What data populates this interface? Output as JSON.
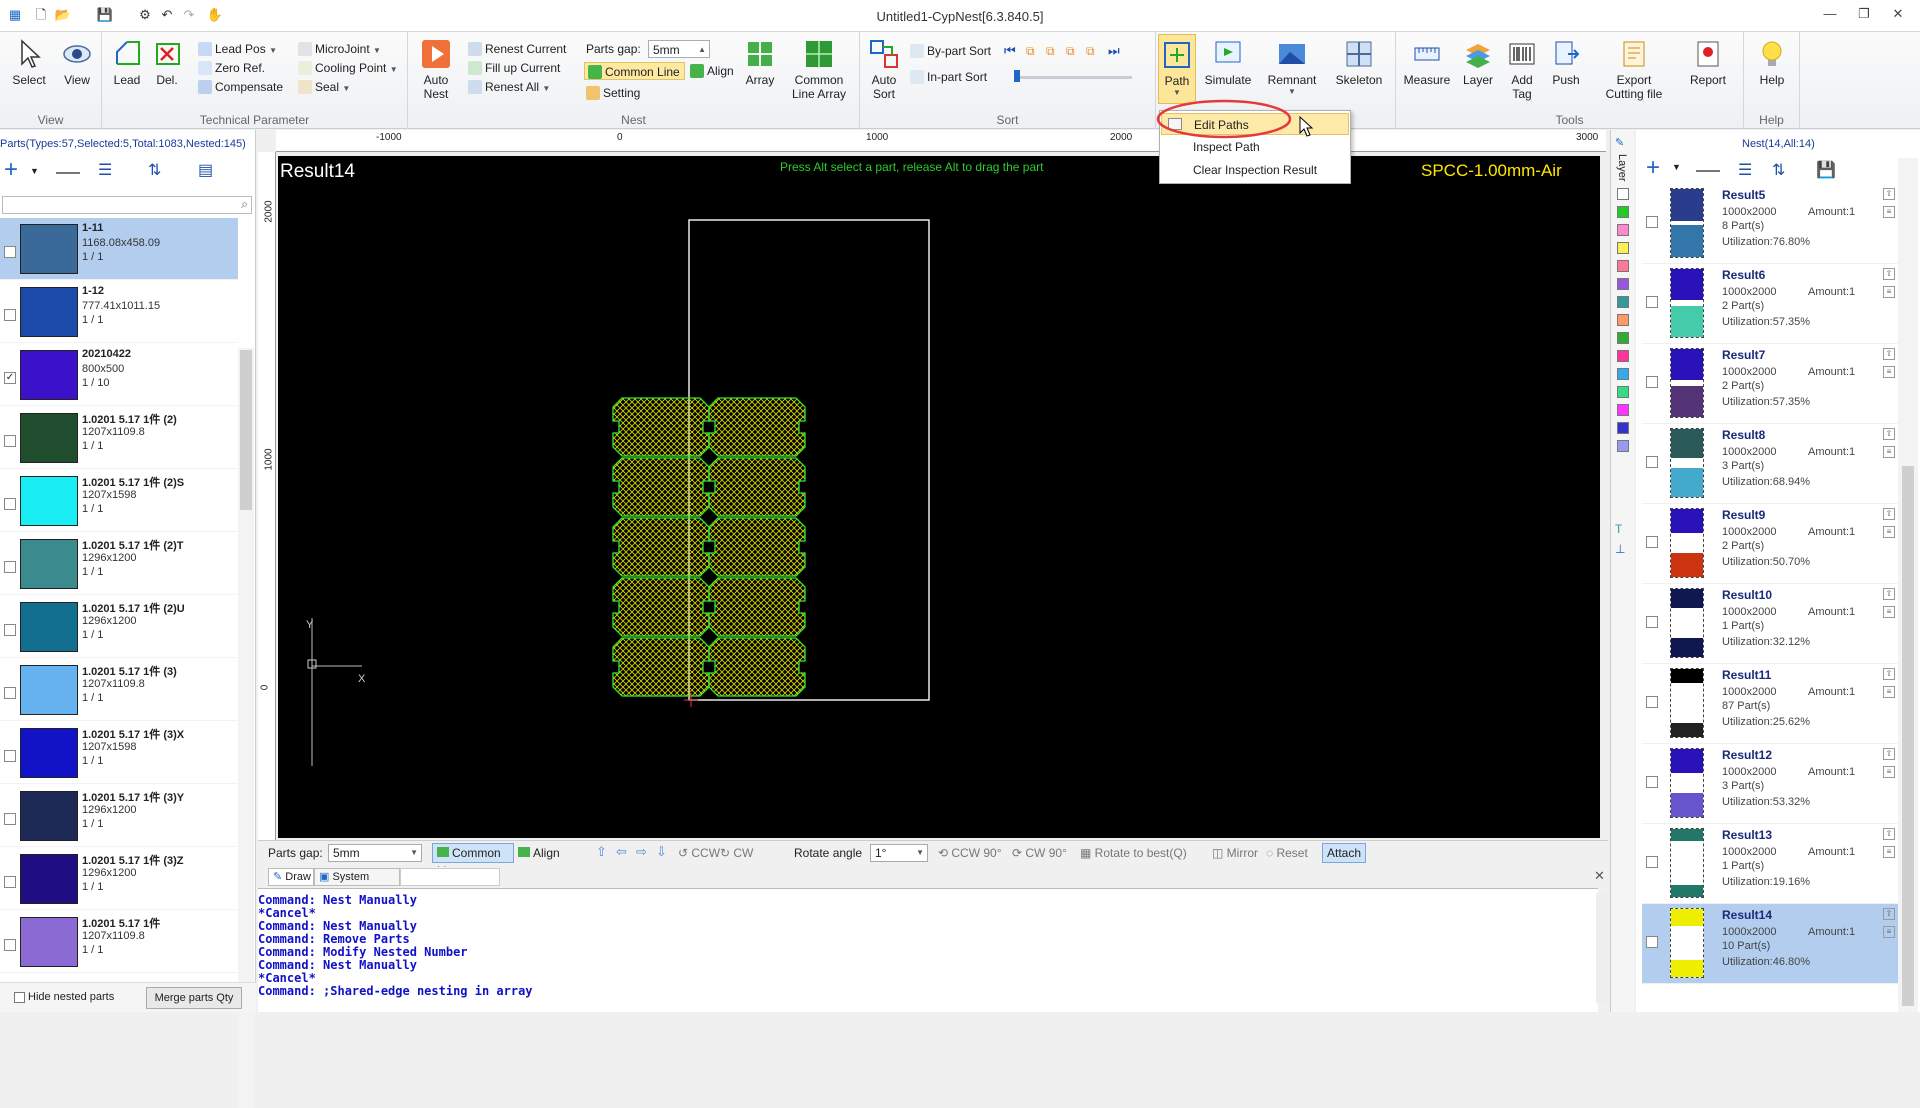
{
  "window": {
    "title": "Untitled1-CypNest[6.3.840.5]"
  },
  "ribbon": {
    "view": {
      "select": "Select",
      "view": "View",
      "group": "View"
    },
    "technical": {
      "lead": "Lead",
      "del": "Del.",
      "lead_pos": "Lead Pos",
      "zero_ref": "Zero Ref.",
      "compensate": "Compensate",
      "microjoint": "MicroJoint",
      "cooling_point": "Cooling Point",
      "seal": "Seal",
      "group": "Technical Parameter"
    },
    "nest": {
      "auto_nest": "Auto\nNest",
      "renest_current": "Renest Current",
      "fill_up_current": "Fill up Current",
      "renest_all": "Renest All",
      "parts_gap_label": "Parts gap:",
      "parts_gap_value": "5mm",
      "common_line": "Common Line",
      "align": "Align",
      "setting": "Setting",
      "array": "Array",
      "common_line_array": "Common\nLine Array",
      "group": "Nest"
    },
    "sort": {
      "auto_sort": "Auto\nSort",
      "by_part_sort": "By-part Sort",
      "in_part_sort": "In-part Sort",
      "group": "Sort"
    },
    "path": {
      "path": "Path",
      "simulate": "Simulate",
      "remnant": "Remnant",
      "skeleton": "Skeleton"
    },
    "tools": {
      "measure": "Measure",
      "layer": "Layer",
      "add_tag": "Add\nTag",
      "push": "Push",
      "export": "Export\nCutting file",
      "report": "Report",
      "group": "Tools"
    },
    "help": {
      "help": "Help",
      "group": "Help"
    }
  },
  "path_menu": {
    "items": [
      "Edit Paths",
      "Inspect Path",
      "Clear Inspection Result"
    ]
  },
  "parts": {
    "status": "Parts(Types:57,Selected:5,Total:1083,Nested:145)",
    "items": [
      {
        "name": "1-11",
        "size": "1168.08x458.09",
        "count": "1 / 1",
        "color": "#3a6a9a",
        "checked": false,
        "selected": true
      },
      {
        "name": "1-12",
        "size": "777.41x1011.15",
        "count": "1 / 1",
        "color": "#1b4aa8",
        "checked": false,
        "selected": false
      },
      {
        "name": "20210422",
        "size": "800x500",
        "count": "1 / 10",
        "color": "#3b12c9",
        "checked": true,
        "selected": false
      },
      {
        "name": "1.0201 5.17 1件 (2)",
        "size": "1207x1109.8",
        "count": "1 / 1",
        "color": "#1f4d2e",
        "checked": false,
        "selected": false
      },
      {
        "name": "1.0201 5.17 1件 (2)S",
        "size": "1207x1598",
        "count": "1 / 1",
        "color": "#19eef5",
        "checked": false,
        "selected": false
      },
      {
        "name": "1.0201 5.17 1件 (2)T",
        "size": "1296x1200",
        "count": "1 / 1",
        "color": "#3a8a8e",
        "checked": false,
        "selected": false
      },
      {
        "name": "1.0201 5.17 1件 (2)U",
        "size": "1296x1200",
        "count": "1 / 1",
        "color": "#136f8f",
        "checked": false,
        "selected": false
      },
      {
        "name": "1.0201 5.17 1件 (3)",
        "size": "1207x1109.8",
        "count": "1 / 1",
        "color": "#66b3f0",
        "checked": false,
        "selected": false
      },
      {
        "name": "1.0201 5.17 1件 (3)X",
        "size": "1207x1598",
        "count": "1 / 1",
        "color": "#1212c6",
        "checked": false,
        "selected": false
      },
      {
        "name": "1.0201 5.17 1件 (3)Y",
        "size": "1296x1200",
        "count": "1 / 1",
        "color": "#1d2a55",
        "checked": false,
        "selected": false
      },
      {
        "name": "1.0201 5.17 1件 (3)Z",
        "size": "1296x1200",
        "count": "1 / 1",
        "color": "#1f0d82",
        "checked": false,
        "selected": false
      },
      {
        "name": "1.0201 5.17 1件",
        "size": "1207x1109.8",
        "count": "1 / 1",
        "color": "#8c6ad4",
        "checked": false,
        "selected": false
      }
    ],
    "hide_nested": "Hide nested parts",
    "merge_btn": "Merge parts Qty"
  },
  "canvas": {
    "result_label": "Result14",
    "hint": "Press Alt select a part, release Alt to drag the part",
    "material": "SPCC-1.00mm-Air",
    "hruler": [
      "-1000",
      "0",
      "1000",
      "2000",
      "3000"
    ],
    "vruler": [
      "2000",
      "1000",
      "0"
    ],
    "axis_y": "Y",
    "axis_x": "X"
  },
  "canvasbar": {
    "parts_gap_label": "Parts gap:",
    "parts_gap_value": "5mm",
    "common_line": "Common Line",
    "align": "Align",
    "ccw": "CCW",
    "cw": "CW",
    "rotate_label": "Rotate angle",
    "rotate_value": "1°",
    "ccw90": "CCW 90°",
    "cw90": "CW 90°",
    "rotate_best": "Rotate to best(Q)",
    "mirror": "Mirror",
    "reset": "Reset",
    "attach": "Attach"
  },
  "cmd": {
    "tab_draw": "Draw",
    "tab_system": "System",
    "lines": [
      "Command: Nest Manually",
      "*Cancel*",
      "Command: Nest Manually",
      "Command: Remove Parts",
      "Command: Modify Nested Number",
      "Command: Nest Manually",
      "*Cancel*",
      "Command: ;Shared-edge nesting in array"
    ]
  },
  "nest_panel": {
    "status": "Nest(14,All:14)",
    "layer_label": "Layer",
    "layer_colors": [
      "#ffffff",
      "#22cc22",
      "#ff88cc",
      "#ffee55",
      "#ff7799",
      "#9955dd",
      "#339999",
      "#ff9966",
      "#33aa33",
      "#ff3399",
      "#33aaee",
      "#33dd88",
      "#ff33ff",
      "#3333cc",
      "#9999ee"
    ],
    "results": [
      {
        "name": "Result5",
        "size": "1000x2000",
        "amount": "Amount:1",
        "parts": "8 Part(s)",
        "util": "Utilization:76.80%",
        "fill": "#2a3c8c",
        "fill2": "#3377aa",
        "cover": 0.95,
        "selected": false
      },
      {
        "name": "Result6",
        "size": "1000x2000",
        "amount": "Amount:1",
        "parts": "2 Part(s)",
        "util": "Utilization:57.35%",
        "fill": "#2a12bb",
        "fill2": "#44ccaa",
        "cover": 0.9,
        "selected": false
      },
      {
        "name": "Result7",
        "size": "1000x2000",
        "amount": "Amount:1",
        "parts": "2 Part(s)",
        "util": "Utilization:57.35%",
        "fill": "#2a12bb",
        "fill2": "#553377",
        "cover": 0.9,
        "selected": false
      },
      {
        "name": "Result8",
        "size": "1000x2000",
        "amount": "Amount:1",
        "parts": "3 Part(s)",
        "util": "Utilization:68.94%",
        "fill": "#2a5a5a",
        "fill2": "#44aacc",
        "cover": 0.85,
        "selected": false
      },
      {
        "name": "Result9",
        "size": "1000x2000",
        "amount": "Amount:1",
        "parts": "2 Part(s)",
        "util": "Utilization:50.70%",
        "fill": "#2a12bb",
        "fill2": "#cc3311",
        "cover": 0.7,
        "selected": false
      },
      {
        "name": "Result10",
        "size": "1000x2000",
        "amount": "Amount:1",
        "parts": "1 Part(s)",
        "util": "Utilization:32.12%",
        "fill": "#101850",
        "fill2": "#101850",
        "cover": 0.55,
        "selected": false
      },
      {
        "name": "Result11",
        "size": "1000x2000",
        "amount": "Amount:1",
        "parts": "87 Part(s)",
        "util": "Utilization:25.62%",
        "fill": "#000000",
        "fill2": "#222222",
        "cover": 0.4,
        "selected": false
      },
      {
        "name": "Result12",
        "size": "1000x2000",
        "amount": "Amount:1",
        "parts": "3 Part(s)",
        "util": "Utilization:53.32%",
        "fill": "#2a12bb",
        "fill2": "#6655cc",
        "cover": 0.7,
        "selected": false
      },
      {
        "name": "Result13",
        "size": "1000x2000",
        "amount": "Amount:1",
        "parts": "1 Part(s)",
        "util": "Utilization:19.16%",
        "fill": "#227766",
        "fill2": "#227766",
        "cover": 0.35,
        "selected": false
      },
      {
        "name": "Result14",
        "size": "1000x2000",
        "amount": "Amount:1",
        "parts": "10 Part(s)",
        "util": "Utilization:46.80%",
        "fill": "#eeee00",
        "fill2": "#eeee00",
        "cover": 0.5,
        "selected": true
      }
    ]
  }
}
